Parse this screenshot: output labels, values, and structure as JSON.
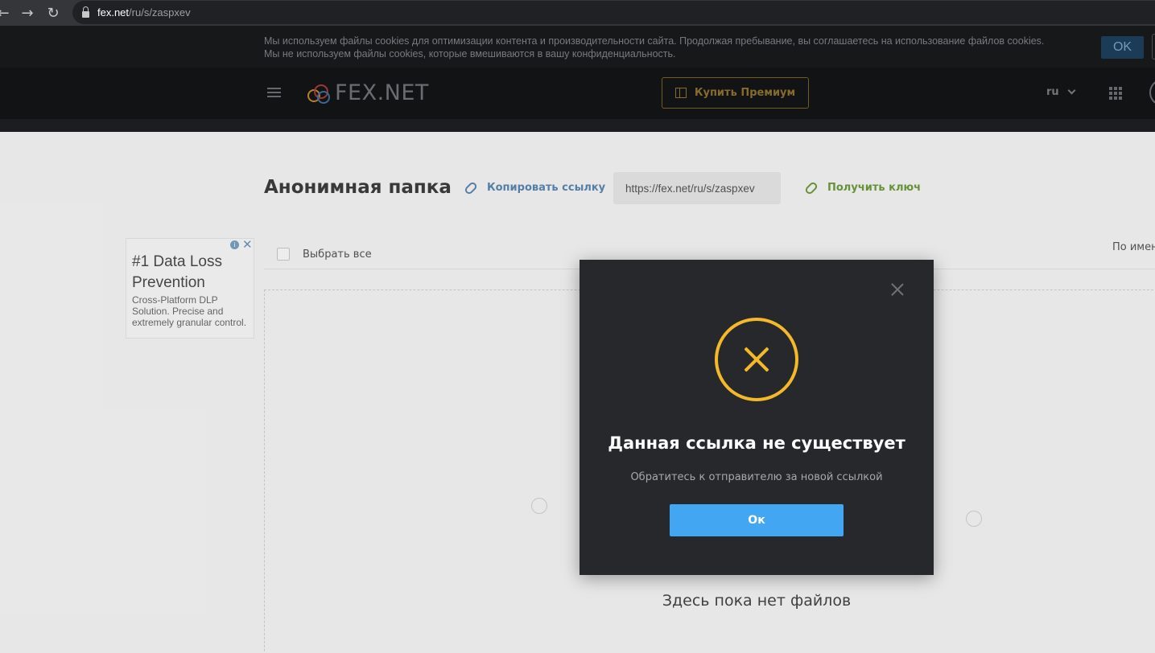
{
  "browser": {
    "url_host": "fex.net",
    "url_path": "/ru/s/zaspxev"
  },
  "cookie_bar": {
    "line1": "Мы используем файлы cookies для оптимизации контента и производительности сайта. Продолжая пребывание, вы соглашаетесь на использование файлов cookies.",
    "line2": "Мы не используем файлы cookies, которые вмешиваются в вашу конфиденциальность.",
    "ok_label": "OK"
  },
  "header": {
    "logo_text": "FEX.NET",
    "premium_label": "Купить Премиум",
    "language": "ru"
  },
  "folder": {
    "title": "Анонимная папка",
    "copy_link_label": "Копировать ссылку",
    "share_url": "https://fex.net/ru/s/zaspxev",
    "get_key_label": "Получить ключ",
    "select_all_label": "Выбрать все",
    "sort_label": "По имени",
    "empty_label": "Здесь пока нет файлов"
  },
  "ad": {
    "title": "#1 Data Loss Prevention",
    "body": "Cross-Platform DLP Solution. Precise and extremely granular control."
  },
  "modal": {
    "title": "Данная ссылка не существует",
    "subtitle": "Обратитесь к отправителю за новой ссылкой",
    "ok_label": "Ок"
  },
  "colors": {
    "accent_blue": "#42a6f2",
    "error_yellow": "#f4b829",
    "modal_bg": "#27282c",
    "header_bg": "#141517"
  }
}
